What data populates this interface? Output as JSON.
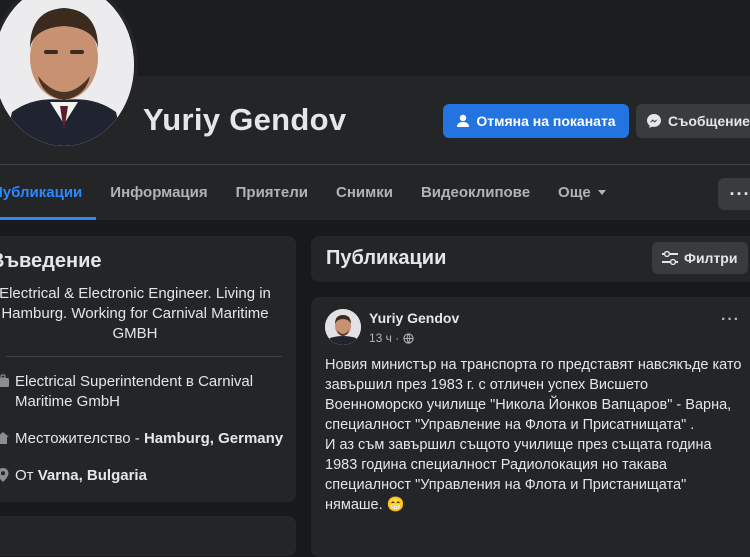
{
  "profile": {
    "name": "Yuriy Gendov",
    "primary_button": "Отмяна на поканата",
    "message_button": "Съобщение"
  },
  "tabs": [
    {
      "label": "Публикации"
    },
    {
      "label": "Информация"
    },
    {
      "label": "Приятели"
    },
    {
      "label": "Снимки"
    },
    {
      "label": "Видеоклипове"
    },
    {
      "label": "Още"
    }
  ],
  "intro": {
    "title": "Въведение",
    "bio": "Electrical & Electronic Engineer. Living in Hamburg. Working for Carnival Maritime GMBH",
    "work": "Electrical Superintendent в Carnival Maritime GmbH",
    "lives_prefix": "Местожителство - ",
    "lives_value": "Hamburg, Germany",
    "from_prefix": "От ",
    "from_value": "Varna, Bulgaria"
  },
  "posts_section": {
    "title": "Публикации",
    "filter_button": "Филтри"
  },
  "post": {
    "author": "Yuriy Gendov",
    "time": "13 ч ·",
    "text": "Новия министър на транспорта го представят навсякъде като  завършил през 1983 г. с отличен успех Висшето Военноморско училище \"Никола Йонков Вапцаров\" - Варна, специалност \"Управление на Флота и Присатнищата\" .\nИ аз съм завършил същото училище през същата година 1983 година специалност Радиолокация но такава специалност \"Управления на Флота и Пристанищата\" нямаше. 😁"
  },
  "colors": {
    "accent": "#2d88ff",
    "button_primary": "#2374e1",
    "card": "#242526",
    "background": "#18191a"
  }
}
